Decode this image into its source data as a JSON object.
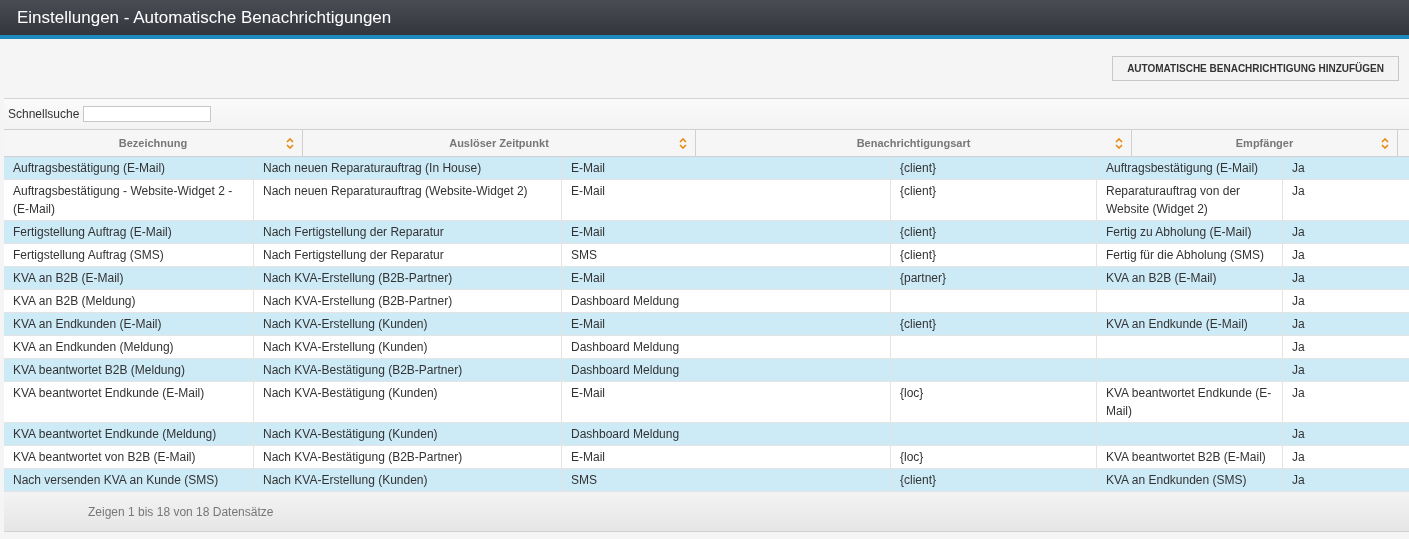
{
  "window": {
    "title": "Einstellungen - Automatische Benachrichtigungen"
  },
  "add_button": "AUTOMATISCHE BENACHRICHTIGUNG HINZUFÜGEN",
  "search": {
    "label": "Schnellsuche"
  },
  "sort_header_bar": {
    "labels": [
      "Bezeichnung",
      "Auslöser Zeitpunkt",
      "Benachrichtigungsart",
      "Empfänger"
    ]
  },
  "table": {
    "rows": [
      [
        "Auftragsbestätigung (E-Mail)",
        "Nach neuen Reparaturauftrag (In House)",
        "E-Mail",
        "{client}",
        "Auftragsbestätigung (E-Mail)",
        "Ja"
      ],
      [
        "Auftragsbestätigung - Website-Widget 2 - (E-Mail)",
        "Nach neuen Reparaturauftrag (Website-Widget 2)",
        "E-Mail",
        "{client}",
        "Reparaturauftrag von der Website (Widget 2)",
        "Ja"
      ],
      [
        "Fertigstellung Auftrag (E-Mail)",
        "Nach Fertigstellung der Reparatur",
        "E-Mail",
        "{client}",
        "Fertig zu Abholung (E-Mail)",
        "Ja"
      ],
      [
        "Fertigstellung Auftrag (SMS)",
        "Nach Fertigstellung der Reparatur",
        "SMS",
        "{client}",
        "Fertig für die Abholung (SMS)",
        "Ja"
      ],
      [
        "KVA an B2B (E-Mail)",
        "Nach KVA-Erstellung (B2B-Partner)",
        "E-Mail",
        "{partner}",
        "KVA an B2B (E-Mail)",
        "Ja"
      ],
      [
        "KVA an B2B (Meldung)",
        "Nach KVA-Erstellung (B2B-Partner)",
        "Dashboard Meldung",
        "",
        "",
        "Ja"
      ],
      [
        "KVA an Endkunden (E-Mail)",
        "Nach KVA-Erstellung (Kunden)",
        "E-Mail",
        "{client}",
        "KVA an Endkunde (E-Mail)",
        "Ja"
      ],
      [
        "KVA an Endkunden (Meldung)",
        "Nach KVA-Erstellung (Kunden)",
        "Dashboard Meldung",
        "",
        "",
        "Ja"
      ],
      [
        "KVA beantwortet B2B (Meldung)",
        "Nach KVA-Bestätigung (B2B-Partner)",
        "Dashboard Meldung",
        "",
        "",
        "Ja"
      ],
      [
        "KVA beantwortet Endkunde (E-Mail)",
        "Nach KVA-Bestätigung (Kunden)",
        "E-Mail",
        "{loc}",
        "KVA beantwortet Endkunde (E-Mail)",
        "Ja"
      ],
      [
        "KVA beantwortet Endkunde (Meldung)",
        "Nach KVA-Bestätigung (Kunden)",
        "Dashboard Meldung",
        "",
        "",
        "Ja"
      ],
      [
        "KVA beantwortet von B2B (E-Mail)",
        "Nach KVA-Bestätigung (B2B-Partner)",
        "E-Mail",
        "{loc}",
        "KVA beantwortet B2B (E-Mail)",
        "Ja"
      ],
      [
        "Nach versenden KVA an Kunde (SMS)",
        "Nach KVA-Erstellung (Kunden)",
        "SMS",
        "{client}",
        "KVA an Endkunden (SMS)",
        "Ja"
      ]
    ]
  },
  "footer": "Zeigen 1 bis 18 von 18 Datensätze"
}
